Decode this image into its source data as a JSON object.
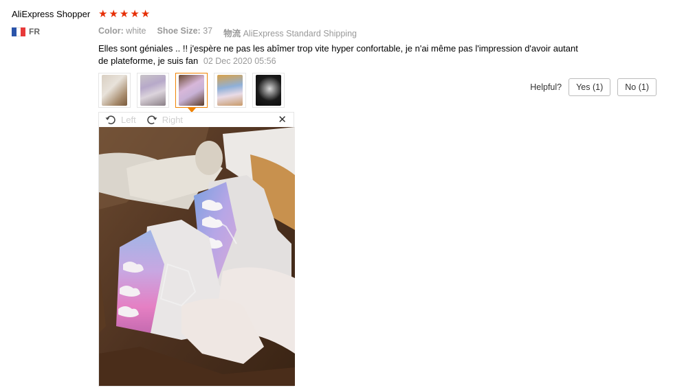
{
  "review": {
    "user_name": "AliExpress Shopper",
    "rating": 5,
    "country_code": "FR",
    "flag_colors": [
      "#2b54a9",
      "#ffffff",
      "#e73a3a"
    ],
    "attributes": [
      {
        "key": "Color:",
        "value": "white"
      },
      {
        "key": "Shoe Size:",
        "value": "37"
      },
      {
        "key": "物流",
        "value": "AliExpress Standard Shipping"
      }
    ],
    "text": "Elles sont géniales .. !! j'espère ne pas les abîmer trop vite hyper confortable, je n'ai même pas l'impression d'avoir autant de plateforme, je suis fan",
    "date": "02 Dec 2020 05:56"
  },
  "thumbnails": [
    {
      "name": "photo-1",
      "active": false
    },
    {
      "name": "photo-2",
      "active": false
    },
    {
      "name": "photo-3",
      "active": true
    },
    {
      "name": "photo-4",
      "active": false
    },
    {
      "name": "photo-5",
      "active": false
    }
  ],
  "helpful": {
    "label": "Helpful?",
    "yes_label": "Yes (1)",
    "no_label": "No (1)"
  },
  "viewer": {
    "rotate_left_label": "Left",
    "rotate_right_label": "Right",
    "close_icon": "close-icon"
  },
  "colors": {
    "star": "#e62e04",
    "active_thumb": "#f08200"
  }
}
